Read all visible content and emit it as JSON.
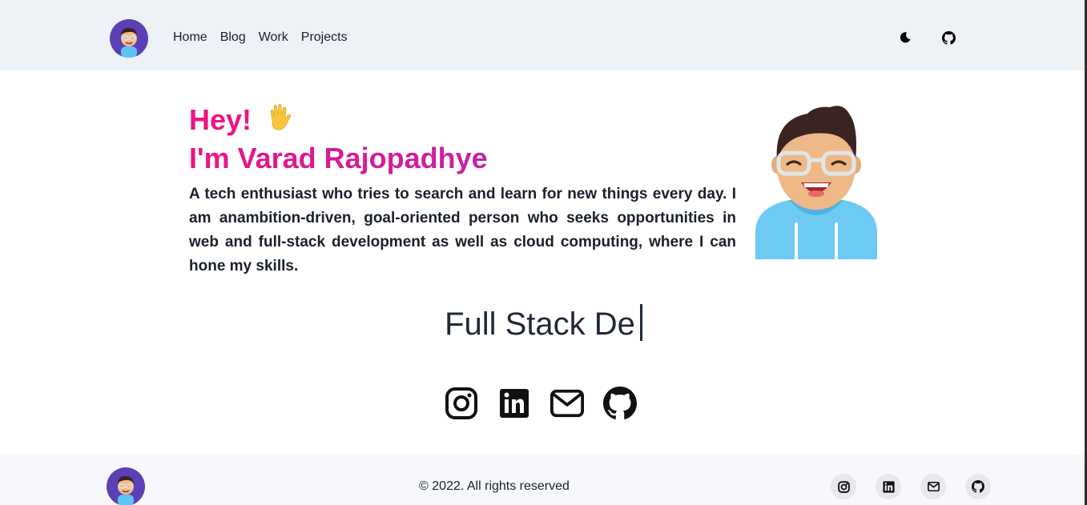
{
  "nav": {
    "links": [
      "Home",
      "Blog",
      "Work",
      "Projects"
    ]
  },
  "hero": {
    "greeting": "Hey!",
    "wave_emoji": "✋",
    "name": "I'm Varad Rajopadhye",
    "bio": "A tech enthusiast who tries to search and learn for new things every day. I am anambition-driven, goal-oriented person who seeks opportunities in web and full-stack development as well as cloud computing, where I can hone my skills."
  },
  "typing": {
    "text": "Full Stack De"
  },
  "footer": {
    "copyright": "© 2022. All rights reserved"
  },
  "colors": {
    "accent_pink": "#ed1384",
    "accent_purple": "#a12fc4",
    "topbar_bg": "#edf2f7",
    "text": "#1a202c"
  }
}
